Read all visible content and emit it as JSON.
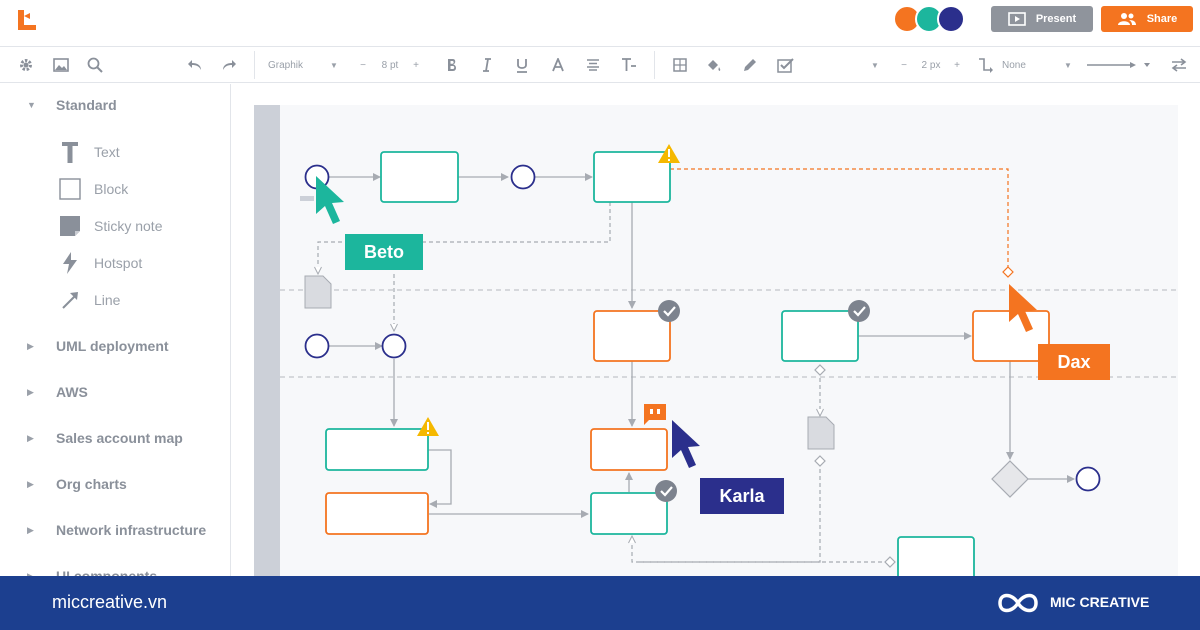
{
  "header": {
    "logo_icon": "lucidchart-logo-icon",
    "collaborators": [
      "#f47420",
      "#1cb69d",
      "#2b2f8c"
    ],
    "present_label": "Present",
    "share_label": "Share"
  },
  "toolbar": {
    "font_family": "Graphik",
    "font_size": "8 pt",
    "line_width": "2 px",
    "line_end": "None",
    "minus": "−",
    "plus": "+"
  },
  "sidebar": {
    "standard_label": "Standard",
    "shapes": [
      {
        "label": "Text",
        "icon": "text-icon"
      },
      {
        "label": "Block",
        "icon": "block-icon"
      },
      {
        "label": "Sticky note",
        "icon": "sticky-note-icon"
      },
      {
        "label": "Hotspot",
        "icon": "hotspot-icon"
      },
      {
        "label": "Line",
        "icon": "line-icon"
      }
    ],
    "categories": [
      "UML deployment",
      "AWS",
      "Sales account map",
      "Org charts",
      "Network infrastructure",
      "UI components"
    ]
  },
  "canvas": {
    "users": [
      {
        "name": "Beto",
        "color": "#1cb69d"
      },
      {
        "name": "Dax",
        "color": "#f47420"
      },
      {
        "name": "Karla",
        "color": "#2b2f8c"
      }
    ]
  },
  "footer": {
    "url": "miccreative.vn",
    "brand": "MIC CREATIVE"
  },
  "colors": {
    "teal": "#1cb69d",
    "orange": "#f47420",
    "navy": "#2b2f8c",
    "footer_blue": "#1c3f8f"
  }
}
